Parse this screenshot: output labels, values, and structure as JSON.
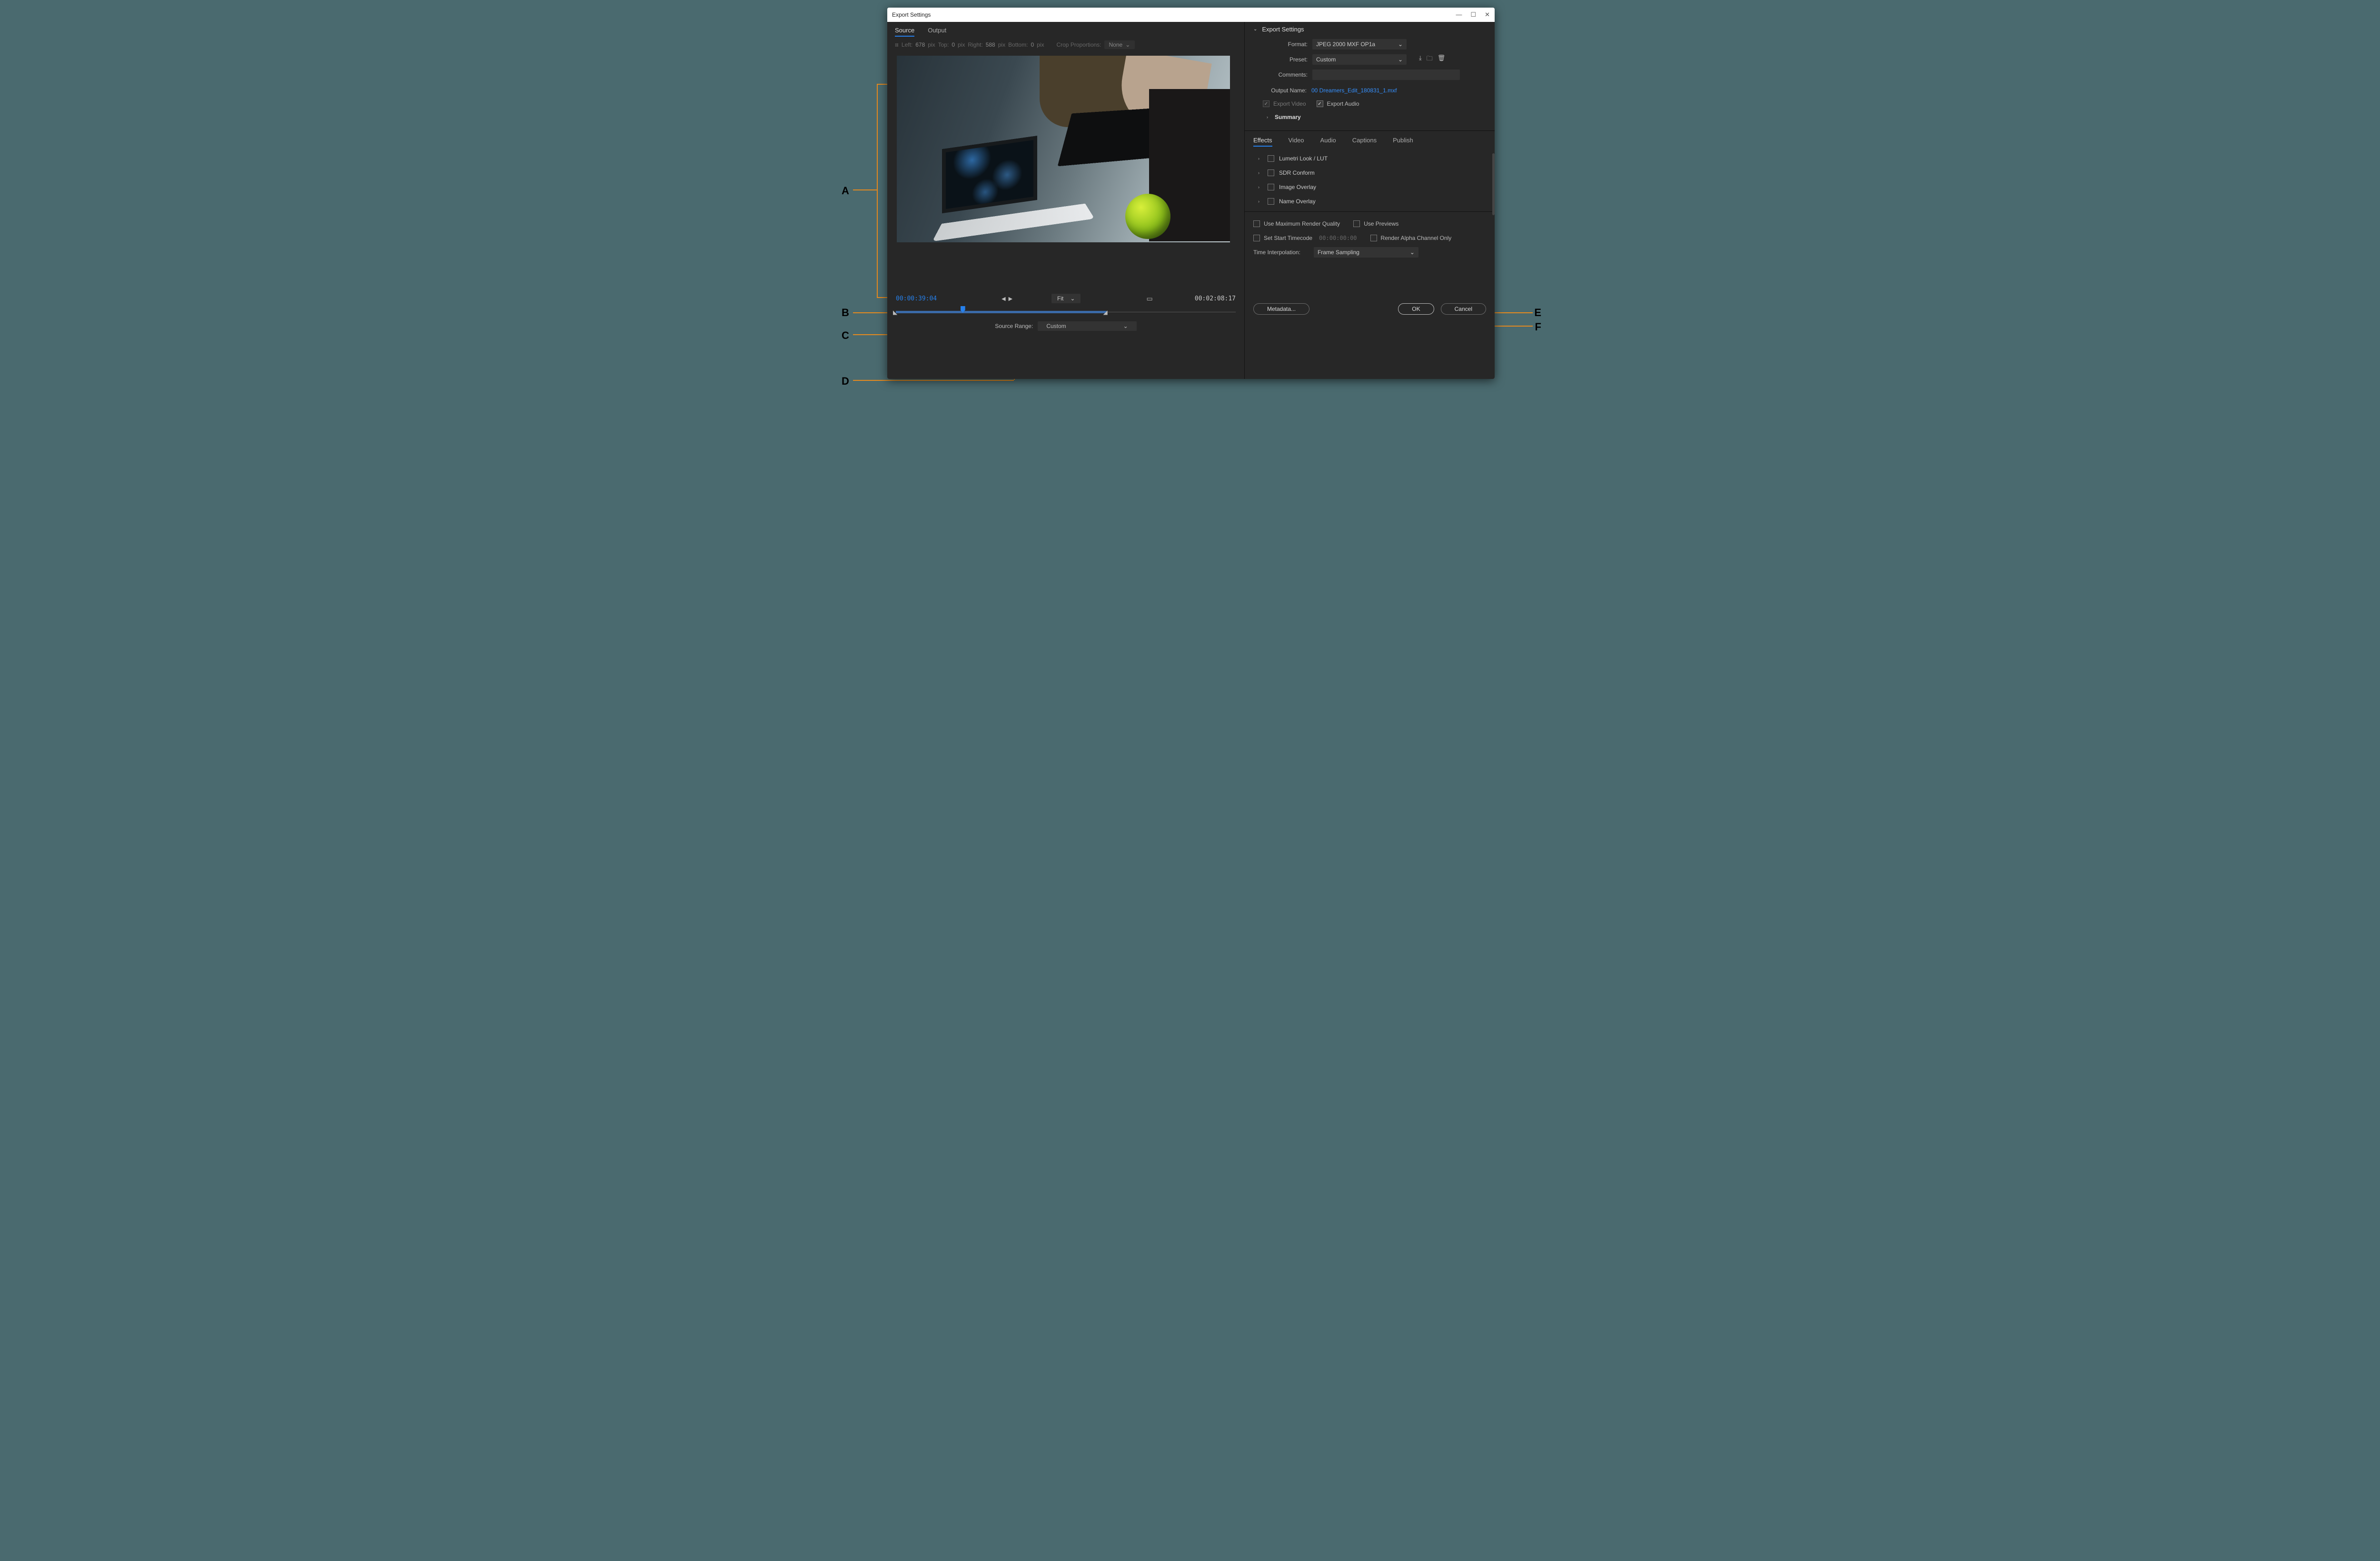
{
  "window": {
    "title": "Export Settings"
  },
  "left": {
    "tabs": {
      "source": "Source",
      "output": "Output"
    },
    "crop": {
      "left_lbl": "Left:",
      "left_val": "678",
      "left_unit": "pix",
      "top_lbl": "Top:",
      "top_val": "0",
      "top_unit": "pix",
      "right_lbl": "Right:",
      "right_val": "588",
      "right_unit": "pix",
      "bottom_lbl": "Bottom:",
      "bottom_val": "0",
      "bottom_unit": "pix",
      "prop_lbl": "Crop Proportions:",
      "prop_val": "None"
    },
    "timecode_in": "00:00:39:04",
    "timecode_out": "00:02:08:17",
    "zoom": "Fit",
    "source_range_lbl": "Source Range:",
    "source_range_val": "Custom"
  },
  "right": {
    "header": "Export Settings",
    "format_lbl": "Format:",
    "format_val": "JPEG 2000 MXF OP1a",
    "preset_lbl": "Preset:",
    "preset_val": "Custom",
    "comments_lbl": "Comments:",
    "comments_val": "",
    "output_lbl": "Output Name:",
    "output_val": "00 Dreamers_Edit_180831_1.mxf",
    "export_video_lbl": "Export Video",
    "export_audio_lbl": "Export Audio",
    "summary_lbl": "Summary",
    "tabs": {
      "effects": "Effects",
      "video": "Video",
      "audio": "Audio",
      "captions": "Captions",
      "publish": "Publish"
    },
    "effects": {
      "lumetri": "Lumetri Look / LUT",
      "sdr": "SDR Conform",
      "imgov": "Image Overlay",
      "nameov": "Name Overlay"
    },
    "render": {
      "max_quality": "Use Maximum Render Quality",
      "previews": "Use Previews",
      "start_tc": "Set Start Timecode",
      "start_tc_val": "00:00:00:00",
      "alpha": "Render Alpha Channel Only",
      "interp_lbl": "Time Interpolation:",
      "interp_val": "Frame Sampling"
    },
    "buttons": {
      "metadata": "Metadata...",
      "ok": "OK",
      "cancel": "Cancel"
    }
  },
  "annotations": {
    "A": "A",
    "B": "B",
    "C": "C",
    "D": "D",
    "E": "E",
    "F": "F"
  }
}
